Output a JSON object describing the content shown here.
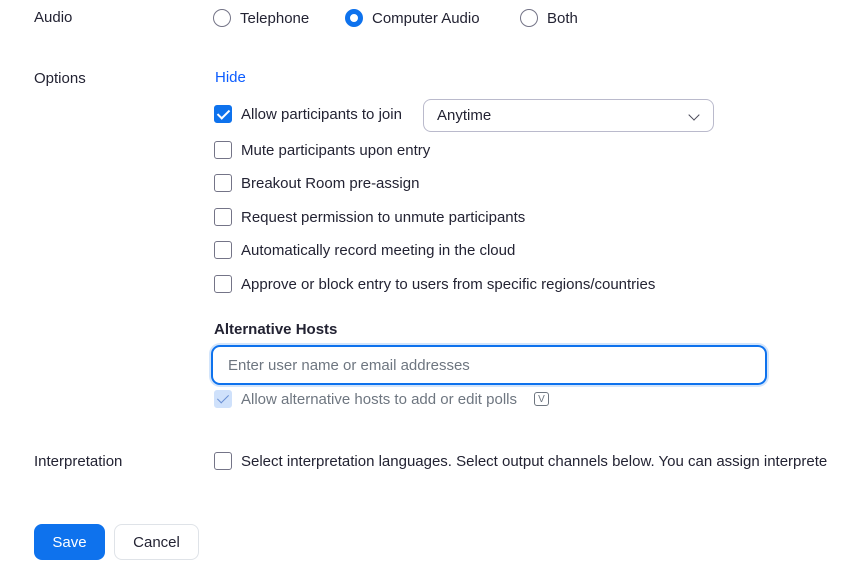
{
  "audio": {
    "label": "Audio",
    "options": [
      {
        "label": "Telephone",
        "checked": false
      },
      {
        "label": "Computer Audio",
        "checked": true
      },
      {
        "label": "Both",
        "checked": false
      }
    ]
  },
  "options": {
    "label": "Options",
    "hide_link": "Hide",
    "allow_join": {
      "label": "Allow participants to join",
      "checked": true,
      "select_value": "Anytime"
    },
    "checkboxes": [
      {
        "label": "Mute participants upon entry",
        "checked": false
      },
      {
        "label": "Breakout Room pre-assign",
        "checked": false
      },
      {
        "label": "Request permission to unmute participants",
        "checked": false
      },
      {
        "label": "Automatically record meeting in the cloud",
        "checked": false
      },
      {
        "label": "Approve or block entry to users from specific regions/countries",
        "checked": false
      }
    ]
  },
  "alternative_hosts": {
    "title": "Alternative Hosts",
    "placeholder": "Enter user name or email addresses",
    "value": "",
    "polls_label": "Allow alternative hosts to add or edit polls",
    "polls_checked": true,
    "badge": "V"
  },
  "interpretation": {
    "label": "Interpretation",
    "checkbox_label": "Select interpretation languages. Select output channels below. You can assign interprete",
    "checked": false
  },
  "actions": {
    "save": "Save",
    "cancel": "Cancel"
  },
  "colors": {
    "accent": "#0e72ed",
    "link": "#0b5cff",
    "text": "#232333"
  }
}
